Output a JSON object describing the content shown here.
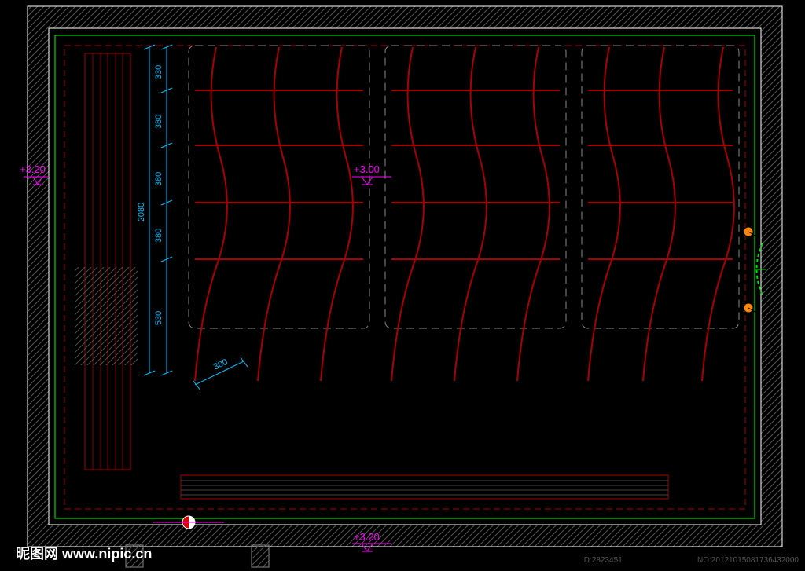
{
  "dimensions": {
    "vertical": {
      "d1": "330",
      "d2": "380",
      "total": "2080",
      "d3": "380",
      "d4": "380",
      "d5": "530"
    },
    "diagonal": "300"
  },
  "elevations": {
    "left": "+3.20",
    "center": "+3.00",
    "bottom": "+3.20"
  },
  "watermark": {
    "site": "昵图网  www.nipic.cn",
    "id_left": "ID:2823451",
    "id_right": "NO:20121015081736432000"
  }
}
